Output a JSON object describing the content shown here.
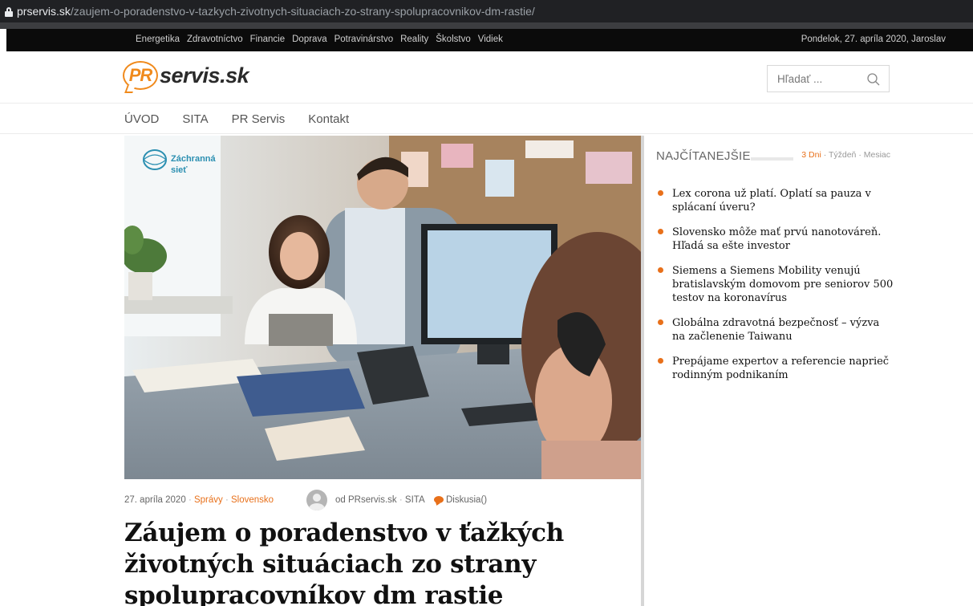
{
  "browser": {
    "url_domain": "prservis.sk",
    "url_path": "/zaujem-o-poradenstvo-v-tazkych-zivotnych-situaciach-zo-strany-spolupracovnikov-dm-rastie/"
  },
  "topnav": {
    "categories": [
      "Energetika",
      "Zdravotníctvo",
      "Financie",
      "Doprava",
      "Potravinárstvo",
      "Reality",
      "Školstvo",
      "Vidiek"
    ],
    "date": "Pondelok, 27. apríla 2020, Jaroslav"
  },
  "header": {
    "logo_pr": "PR",
    "logo_name": "servis.sk",
    "search_placeholder": "Hľadať ..."
  },
  "mainnav": {
    "items": [
      "ÚVOD",
      "SITA",
      "PR Servis",
      "Kontakt"
    ]
  },
  "photo": {
    "badge_line1": "Záchranná",
    "badge_line2": "sieť"
  },
  "article": {
    "date": "27. apríla 2020",
    "cat1": "Správy",
    "cat2": "Slovensko",
    "author": "od PRservis.sk",
    "source": "SITA",
    "discussion": "Diskusia()",
    "title": "Záujem o poradenstvo v ťažkých životných situáciach zo strany spolupracovníkov dm rastie"
  },
  "sidebar": {
    "title": "NAJČÍTANEJŠIE",
    "tabs": [
      "3 Dni",
      "Týždeň",
      "Mesiac"
    ],
    "items": [
      "Lex corona už platí. Oplatí sa pauza v splácaní úveru?",
      "Slovensko môže mať prvú nanotováreň. Hľadá sa ešte investor",
      "Siemens a Siemens Mobility venujú bratislavským domovom pre seniorov 500 testov na koronavírus",
      "Globálna zdravotná bezpečnosť – výzva na začlenenie Taiwanu",
      "Prepájame expertov a referencie naprieč rodinným podnikaním"
    ]
  },
  "colors": {
    "accent": "#e8701a",
    "logo_orange": "#f08a1c",
    "topbar": "#0b0b0b"
  }
}
